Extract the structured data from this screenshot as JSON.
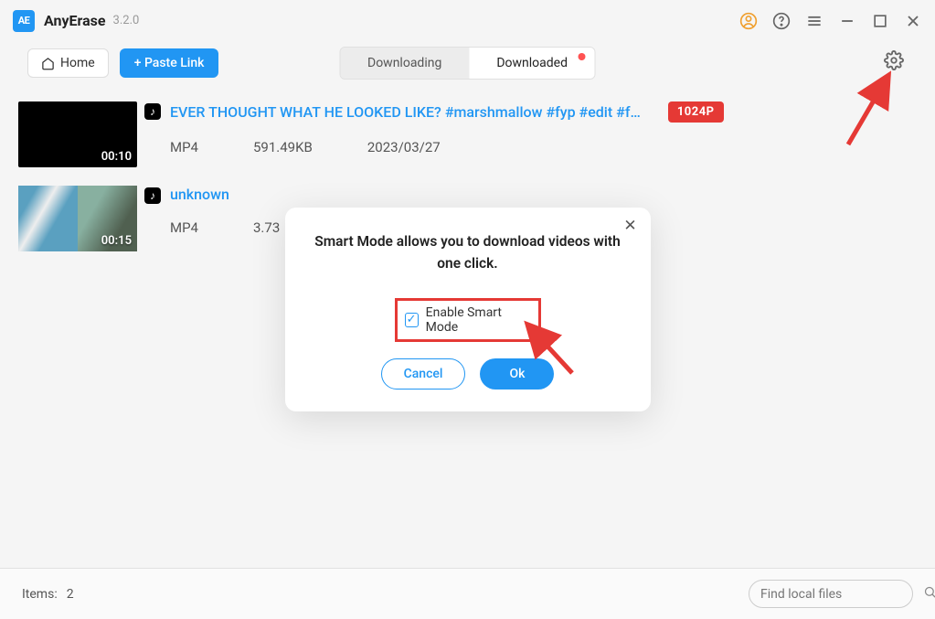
{
  "app": {
    "name": "AnyErase",
    "version": "3.2.0",
    "logo_text": "AE"
  },
  "toolbar": {
    "home_label": "Home",
    "paste_label": "+ Paste Link",
    "tabs": {
      "downloading": "Downloading",
      "downloaded": "Downloaded"
    }
  },
  "items": [
    {
      "title": "EVER THOUGHT WHAT HE LOOKED LIKE? #marshmallow #fyp #edit #f…",
      "duration": "00:10",
      "format": "MP4",
      "size": "591.49KB",
      "date": "2023/03/27",
      "badge": "1024P",
      "source_icon": "tiktok"
    },
    {
      "title": "unknown",
      "duration": "00:15",
      "format": "MP4",
      "size": "3.73",
      "date": "",
      "badge": "",
      "source_icon": "tiktok"
    }
  ],
  "modal": {
    "text": "Smart Mode allows you to download videos with one click.",
    "checkbox_label": "Enable Smart Mode",
    "cancel": "Cancel",
    "ok": "Ok"
  },
  "footer": {
    "items_label": "Items:",
    "items_count": "2",
    "search_placeholder": "Find local files"
  }
}
